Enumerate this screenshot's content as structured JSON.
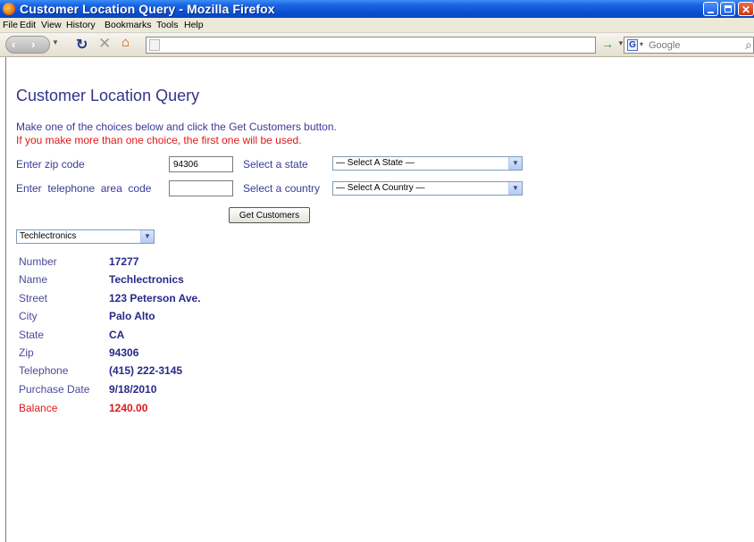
{
  "window": {
    "title": "Customer Location Query - Mozilla Firefox"
  },
  "menu": [
    "File",
    "Edit",
    "View",
    "History",
    "Bookmarks",
    "Tools",
    "Help"
  ],
  "toolbar": {
    "url": "",
    "search_placeholder": "Google"
  },
  "page": {
    "title": "Customer Location Query",
    "instruction": "Make one of the choices below and click the Get Customers button.",
    "warning": "If you make more than one choice, the first one will be used.",
    "zip_label": "Enter zip code",
    "zip_value": "94306",
    "phone_label": "Enter  telephone  area  code",
    "phone_value": "",
    "state_label": "Select a state",
    "state_selected": "— Select A State —",
    "country_label": "Select a country",
    "country_selected": "— Select A Country —",
    "get_button": "Get Customers",
    "customer_selected": "Techlectronics"
  },
  "customer": [
    {
      "label": "Number",
      "value": "17277"
    },
    {
      "label": "Name",
      "value": "Techlectronics"
    },
    {
      "label": "Street",
      "value": "123 Peterson Ave."
    },
    {
      "label": "City",
      "value": "Palo Alto"
    },
    {
      "label": "State",
      "value": "CA"
    },
    {
      "label": "Zip",
      "value": "94306"
    },
    {
      "label": "Telephone",
      "value": "(415) 222-3145"
    },
    {
      "label": "Purchase Date",
      "value": "9/18/2010"
    },
    {
      "label": "Balance",
      "value": "1240.00"
    }
  ],
  "colors": {
    "heading": "#33338a",
    "warning": "#e01818",
    "value": "#28288a"
  }
}
